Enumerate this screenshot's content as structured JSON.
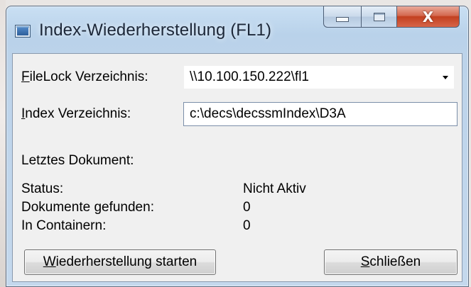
{
  "window": {
    "title": "Index-Wiederherstellung (FL1)",
    "close_glyph": "X",
    "icons": {
      "app": "app-window-icon",
      "minimize": "minimize-icon",
      "maximize": "maximize-icon",
      "close": "close-icon"
    }
  },
  "form": {
    "filelock": {
      "label_mnemonic": "F",
      "label_rest": "ileLock Verzeichnis:",
      "value": "\\\\10.100.150.222\\fl1"
    },
    "index": {
      "label_mnemonic": "I",
      "label_rest": "ndex Verzeichnis:",
      "value": "c:\\decs\\decssmIndex\\D3A"
    }
  },
  "info": {
    "last_document_label": "Letztes Dokument:",
    "status_label": "Status:",
    "status_value": "Nicht Aktiv",
    "found_label": "Dokumente gefunden:",
    "found_value": "0",
    "containers_label": "In Containern:",
    "containers_value": "0"
  },
  "buttons": {
    "start": {
      "mnemonic": "W",
      "rest": "iederherstellung starten"
    },
    "close": {
      "mnemonic": "S",
      "rest": "chließen"
    }
  },
  "colors": {
    "close_button": "#c2401f",
    "title_text": "#1c2738"
  }
}
